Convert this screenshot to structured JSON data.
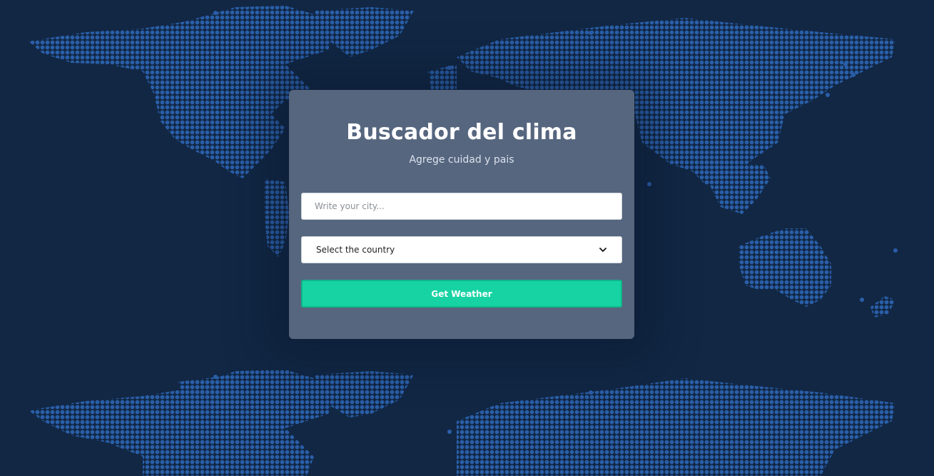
{
  "page": {
    "background_color": "#112744",
    "map_dot_color": "#2a5ea8"
  },
  "card": {
    "title": "Buscador del clima",
    "subtitle": "Agrege cuidad y pais",
    "city_input": {
      "placeholder": "Write your city...",
      "value": ""
    },
    "country_select": {
      "selected": "Select the country",
      "icon": "chevron-down-icon"
    },
    "submit_button": {
      "label": "Get Weather",
      "color": "#17d3a4"
    }
  }
}
